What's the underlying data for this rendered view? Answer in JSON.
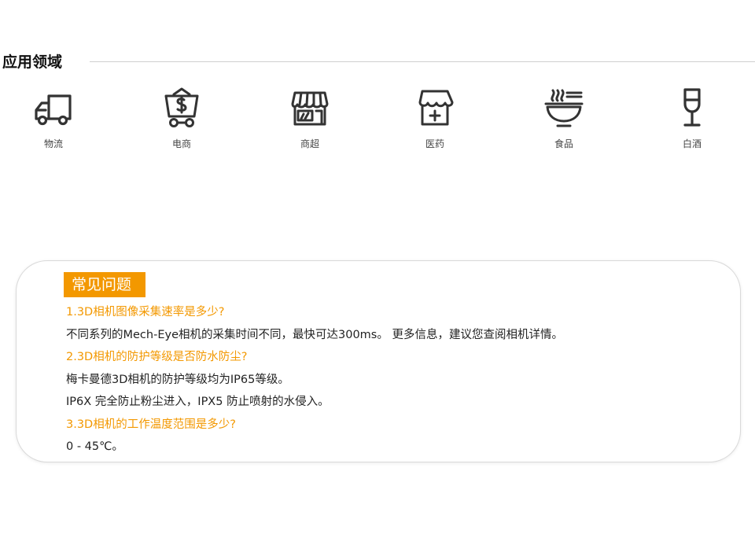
{
  "section": {
    "title": "应用领域"
  },
  "apps": [
    {
      "label": "物流",
      "icon": "truck-icon"
    },
    {
      "label": "电商",
      "icon": "shopping-cart-icon"
    },
    {
      "label": "商超",
      "icon": "storefront-icon"
    },
    {
      "label": "医药",
      "icon": "pharmacy-icon"
    },
    {
      "label": "食品",
      "icon": "noodle-bowl-icon"
    },
    {
      "label": "白酒",
      "icon": "wine-glass-icon"
    }
  ],
  "faq": {
    "title": "常见问题",
    "items": [
      {
        "question": "1.3D相机图像采集速率是多少?",
        "answers": [
          "不同系列的Mech-Eye相机的采集时间不同，最快可达300ms。 更多信息，建议您查阅相机详情。"
        ]
      },
      {
        "question": "2.3D相机的防护等级是否防水防尘?",
        "answers": [
          "梅卡曼德3D相机的防护等级均为IP65等级。",
          "IP6X 完全防止粉尘进入，IPX5 防止喷射的水侵入。"
        ]
      },
      {
        "question": "3.3D相机的工作温度范围是多少?",
        "answers": [
          "0 - 45℃。"
        ]
      }
    ]
  },
  "colors": {
    "accent": "#f39800",
    "icon": "#333333",
    "rule": "#cfcfcf"
  }
}
